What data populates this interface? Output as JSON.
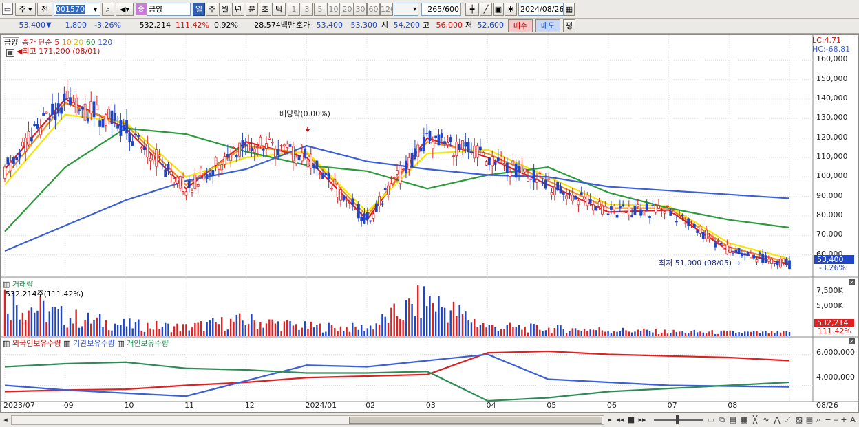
{
  "toolbar": {
    "mode_stock": "주",
    "mode_prev": "전",
    "code": "001570",
    "name_badge": "종",
    "name": "금양",
    "periods": [
      "일",
      "주",
      "월",
      "년",
      "분",
      "초",
      "틱"
    ],
    "active_period": "일",
    "ticks": [
      "1",
      "3",
      "5",
      "10",
      "20",
      "30",
      "60",
      "120"
    ],
    "count": "265",
    "count_total": "/600",
    "date": "2024/08/26"
  },
  "quote": {
    "price": "53,400",
    "change": "1,800",
    "change_pct": "-3.26%",
    "volume": "532,214",
    "vol_ratio": "111.42%",
    "turnover": "0.92%",
    "amount": "28,574백만",
    "bid_label": "호가",
    "ask": "53,400",
    "bid": "53,300",
    "open_label": "시",
    "open": "54,200",
    "high_label": "고",
    "high": "56,000",
    "low_label": "저",
    "low": "52,600",
    "buy_label": "매수",
    "sell_label": "매도",
    "avg_label": "평"
  },
  "price_panel": {
    "name": "금양",
    "legend_prefix": "종가 단순",
    "ma_labels": [
      "5",
      "10",
      "20",
      "60",
      "120"
    ],
    "high_note": "최고 171,200 (08/01)",
    "low_note": "최저 51,000 (08/05)",
    "dividend_note": "배당락(0.00%)",
    "lc": "LC:4.71",
    "hc": "HC:-68.81",
    "y_ticks": [
      "160,000",
      "150,000",
      "140,000",
      "130,000",
      "120,000",
      "110,000",
      "100,000",
      "90,000",
      "80,000",
      "70,000",
      "60,000"
    ],
    "last_tag": "53,400",
    "last_pct": "-3.26%"
  },
  "volume_panel": {
    "title": "거래량",
    "info": "532,214주(111.42%)",
    "y_ticks": [
      "7,500K",
      "5,000K",
      "2,500K"
    ],
    "last_tag": "532,214",
    "last_pct": "111.42%"
  },
  "holding_panel": {
    "series": [
      "외국인보유수량",
      "기관보유수량",
      "개인보유수량"
    ],
    "y_ticks": [
      "6,000,000",
      "4,000,000"
    ]
  },
  "x_axis": [
    "2023/07",
    "09",
    "10",
    "11",
    "12",
    "2024/01",
    "02",
    "03",
    "04",
    "05",
    "06",
    "07",
    "08",
    "08/26"
  ],
  "colors": {
    "ma5": "#e02020",
    "ma10": "#f08a1c",
    "ma20": "#f5e600",
    "ma60": "#2a9a3a",
    "ma120": "#3a5fd8",
    "up": "#e02020",
    "down": "#1f45c8",
    "foreign": "#e02020",
    "inst": "#3a5fd8",
    "retail": "#2e8b57"
  },
  "chart_data": {
    "type": "line",
    "title": "금양",
    "x": [
      "2023/07",
      "09",
      "10",
      "11",
      "12",
      "2024/01",
      "02",
      "03",
      "04",
      "05",
      "06",
      "07",
      "08",
      "08/26"
    ],
    "series": [
      {
        "name": "5",
        "values": [
          104000,
          140000,
          125000,
          94000,
          118000,
          110000,
          78000,
          120000,
          110000,
          96000,
          82000,
          83000,
          62000,
          55000
        ]
      },
      {
        "name": "10",
        "values": [
          100000,
          138000,
          127000,
          96000,
          116000,
          112000,
          80000,
          118000,
          112000,
          98000,
          84000,
          84000,
          64000,
          56000
        ]
      },
      {
        "name": "20",
        "values": [
          96000,
          132000,
          128000,
          100000,
          110000,
          113000,
          82000,
          112000,
          114000,
          100000,
          86000,
          85000,
          66000,
          58000
        ]
      },
      {
        "name": "60",
        "values": [
          72000,
          105000,
          125000,
          122000,
          113000,
          106000,
          103000,
          94000,
          101000,
          105000,
          92000,
          84000,
          78000,
          74000
        ]
      },
      {
        "name": "120",
        "values": [
          62000,
          75000,
          88000,
          98000,
          104000,
          116000,
          108000,
          104000,
          101000,
          100000,
          95000,
          93000,
          91000,
          89000
        ]
      }
    ],
    "ylim": [
      50000,
      170000
    ],
    "y_ticks": [
      60000,
      70000,
      80000,
      90000,
      100000,
      110000,
      120000,
      130000,
      140000,
      150000,
      160000
    ],
    "annotations": [
      "최고 171,200 (08/01)",
      "최저 51,000 (08/05)",
      "배당락(0.00%)"
    ],
    "volume_k": [
      6000,
      3000,
      1800,
      1400,
      2500,
      1500,
      1300,
      5800,
      1500,
      1200,
      1000,
      700,
      600,
      532
    ],
    "holdings": {
      "외국인보유수량": [
        3600000,
        3700000,
        3750000,
        4000000,
        4200000,
        4500000,
        4600000,
        4700000,
        6100000,
        6200000,
        6000000,
        5900000,
        5800000,
        5600000
      ],
      "기관보유수량": [
        4000000,
        3700000,
        3500000,
        3300000,
        4300000,
        5300000,
        5200000,
        5600000,
        6000000,
        4400000,
        4200000,
        4000000,
        3950000,
        3900000
      ],
      "개인보유수량": [
        5200000,
        5400000,
        5500000,
        5100000,
        5000000,
        4800000,
        4800000,
        4900000,
        3000000,
        3200000,
        3600000,
        3800000,
        4000000,
        4200000
      ]
    },
    "holdings_ticks": [
      4000000,
      6000000
    ]
  }
}
